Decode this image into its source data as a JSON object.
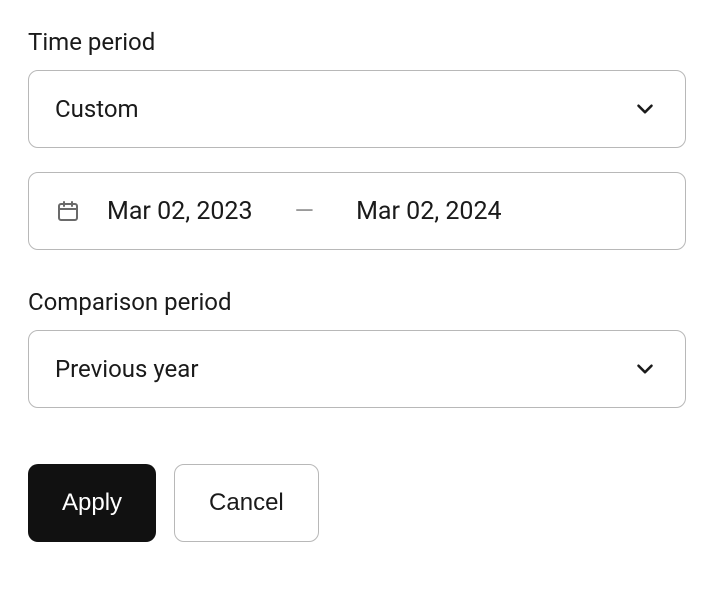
{
  "timePeriod": {
    "label": "Time period",
    "selected": "Custom"
  },
  "dateRange": {
    "start": "Mar 02, 2023",
    "separator": "—",
    "end": "Mar 02, 2024"
  },
  "comparisonPeriod": {
    "label": "Comparison period",
    "selected": "Previous year"
  },
  "actions": {
    "apply": "Apply",
    "cancel": "Cancel"
  }
}
